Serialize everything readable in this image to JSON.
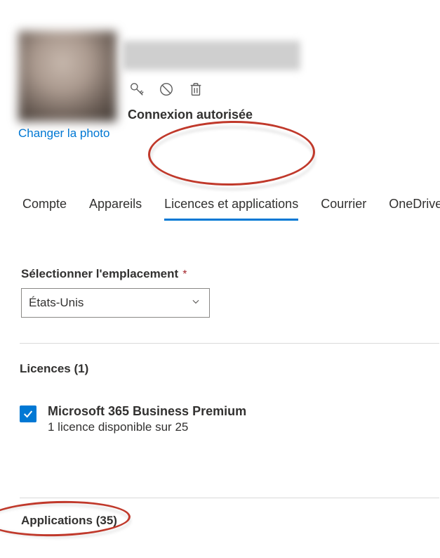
{
  "header": {
    "change_photo": "Changer la photo",
    "signin_status": "Connexion autorisée"
  },
  "tabs": {
    "account": "Compte",
    "devices": "Appareils",
    "licenses": "Licences et applications",
    "mail": "Courrier",
    "onedrive": "OneDrive"
  },
  "location": {
    "label": "Sélectionner l'emplacement",
    "value": "États-Unis"
  },
  "licenses": {
    "heading": "Licences (1)",
    "items": [
      {
        "name": "Microsoft 365 Business Premium",
        "sub": "1 licence disponible sur 25",
        "checked": true
      }
    ]
  },
  "apps": {
    "heading": "Applications (35)"
  }
}
